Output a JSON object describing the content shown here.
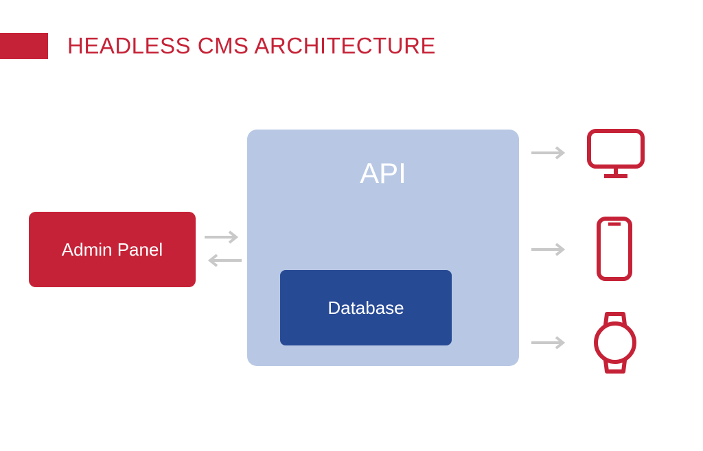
{
  "title": "HEADLESS CMS ARCHITECTURE",
  "admin_panel": {
    "label": "Admin Panel"
  },
  "api": {
    "label": "API"
  },
  "database": {
    "label": "Database"
  },
  "devices": {
    "desktop": "desktop",
    "mobile": "mobile",
    "watch": "smartwatch"
  },
  "colors": {
    "brand_red": "#c62237",
    "api_blue": "#b8c8e4",
    "db_blue": "#274a95",
    "arrow_grey": "#c9c9c9"
  }
}
